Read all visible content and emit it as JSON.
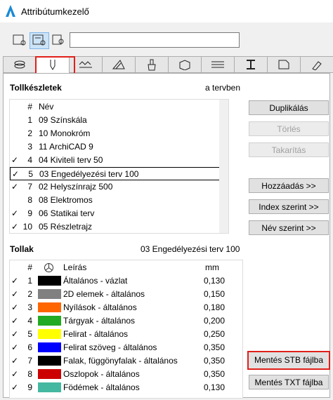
{
  "window": {
    "title": "Attribútumkezelő"
  },
  "search": {
    "value": ""
  },
  "sets_section": {
    "title": "Tollkészletek",
    "scope": "a tervben"
  },
  "sets_header": {
    "num": "#",
    "name": "Név"
  },
  "sets": [
    {
      "check": "",
      "num": "1",
      "name": "09 Színskála"
    },
    {
      "check": "",
      "num": "2",
      "name": "10 Monokróm"
    },
    {
      "check": "",
      "num": "3",
      "name": "11 ArchiCAD 9"
    },
    {
      "check": "✓",
      "num": "4",
      "name": "04 Kiviteli terv 50"
    },
    {
      "check": "✓",
      "num": "5",
      "name": "03 Engedélyezési terv 100"
    },
    {
      "check": "✓",
      "num": "7",
      "name": "02 Helyszínrajz 500"
    },
    {
      "check": "",
      "num": "8",
      "name": "08 Elektromos"
    },
    {
      "check": "✓",
      "num": "9",
      "name": "06 Statikai terv"
    },
    {
      "check": "✓",
      "num": "10",
      "name": "05 Részletrajz"
    }
  ],
  "buttons": {
    "duplicate": "Duplikálás",
    "delete": "Törlés",
    "purge": "Takarítás",
    "add": "Hozzáadás >>",
    "by_index": "Index szerint >>",
    "by_name": "Név szerint >>",
    "save_stb": "Mentés STB fájlba",
    "save_txt": "Mentés TXT fájlba"
  },
  "pens_section": {
    "title": "Tollak",
    "set_name": "03 Engedélyezési terv 100"
  },
  "pens_header": {
    "num": "#",
    "desc": "Leírás",
    "unit": "mm"
  },
  "pens": [
    {
      "check": "✓",
      "num": "1",
      "color": "#000000",
      "desc": "Általános - vázlat",
      "mm": "0,130"
    },
    {
      "check": "✓",
      "num": "2",
      "color": "#808080",
      "desc": "2D elemek - általános",
      "mm": "0,150"
    },
    {
      "check": "✓",
      "num": "3",
      "color": "#ff6600",
      "desc": "Nyílások - általános",
      "mm": "0,180"
    },
    {
      "check": "✓",
      "num": "4",
      "color": "#22aa22",
      "desc": "Tárgyak - általános",
      "mm": "0,200"
    },
    {
      "check": "✓",
      "num": "5",
      "color": "#ffff00",
      "desc": "Felirat - általános",
      "mm": "0,250"
    },
    {
      "check": "✓",
      "num": "6",
      "color": "#0000ff",
      "desc": "Felirat szöveg - általános",
      "mm": "0,350"
    },
    {
      "check": "✓",
      "num": "7",
      "color": "#000000",
      "desc": "Falak, függönyfalak - általános",
      "mm": "0,350"
    },
    {
      "check": "✓",
      "num": "8",
      "color": "#cc0000",
      "desc": "Oszlopok - általános",
      "mm": "0,350"
    },
    {
      "check": "✓",
      "num": "9",
      "color": "#44b8a0",
      "desc": "Födémek - általános",
      "mm": "0,130"
    }
  ]
}
